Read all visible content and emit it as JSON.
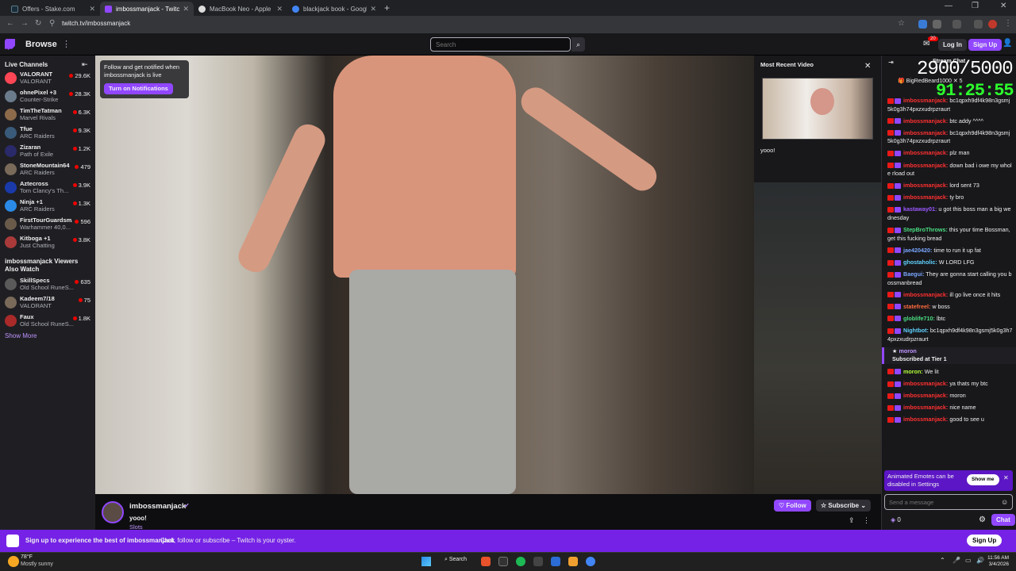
{
  "browser": {
    "tabs": [
      {
        "title": "Offers - Stake.com",
        "color": "#1a2c38"
      },
      {
        "title": "imbossmanjack - Twitch",
        "color": "#9147ff"
      },
      {
        "title": "MacBook Neo - Apple (UK)",
        "color": "#cccccc"
      },
      {
        "title": "blackjack book - Google Search",
        "color": "#4285f4"
      }
    ],
    "url": "twitch.tv/imbossmanjack"
  },
  "nav": {
    "browse": "Browse",
    "search_placeholder": "Search",
    "notif_count": "20",
    "login": "Log In",
    "signup": "Sign Up"
  },
  "sidebar": {
    "live_title": "Live Channels",
    "channels": [
      {
        "name": "VALORANT",
        "game": "VALORANT",
        "viewers": "29.6K",
        "color": "#ff4655"
      },
      {
        "name": "ohnePixel +3",
        "game": "Counter-Strike",
        "viewers": "28.3K",
        "color": "#6a7b8c"
      },
      {
        "name": "TimTheTatman",
        "game": "Marvel Rivals",
        "viewers": "6.3K",
        "color": "#8c6a4a"
      },
      {
        "name": "Tfue",
        "game": "ARC Raiders",
        "viewers": "9.3K",
        "color": "#3a5a7a"
      },
      {
        "name": "Zizaran",
        "game": "Path of Exile",
        "viewers": "1.2K",
        "color": "#2a2a6a"
      },
      {
        "name": "StoneMountain64",
        "game": "ARC Raiders",
        "viewers": "479",
        "color": "#7a6a5a"
      },
      {
        "name": "Aztecross",
        "game": "Tom Clancy's Th...",
        "viewers": "3.9K",
        "color": "#1a3aaa"
      },
      {
        "name": "Ninja +1",
        "game": "ARC Raiders",
        "viewers": "1.3K",
        "color": "#2a8ae6"
      },
      {
        "name": "FirstTourGuardsm...",
        "game": "Warhammer 40,0...",
        "viewers": "596",
        "color": "#6a5a4a"
      },
      {
        "name": "Kitboga +1",
        "game": "Just Chatting",
        "viewers": "3.8K",
        "color": "#aa3a3a"
      }
    ],
    "also_title": "imbossmanjack Viewers Also Watch",
    "also": [
      {
        "name": "SkillSpecs",
        "game": "Old School RuneS...",
        "viewers": "635",
        "color": "#5a5a5a"
      },
      {
        "name": "Kadeem7/18",
        "game": "VALORANT",
        "viewers": "75",
        "color": "#7a6a5a"
      },
      {
        "name": "Faux",
        "game": "Old School RuneS...",
        "viewers": "1.8K",
        "color": "#aa2a2a"
      }
    ],
    "show_more": "Show More"
  },
  "follow_popup": {
    "text": "Follow and get notified when imbossmanjack is live",
    "button": "Turn on Notifications"
  },
  "recent": {
    "title": "Most Recent Video",
    "caption": "yooo!"
  },
  "chat": {
    "title": "Stream Chat",
    "overlay_count": "2900/5000",
    "overlay_timer": "91:25:55",
    "pinned": "BigRedBeard1000 ✕ 5",
    "messages": [
      {
        "user": "imbossmanjack:",
        "text": " bc1qpxh9df4k98n3gsmj5k0g3h74pxzxudrpzraurt",
        "ucolor": "#ff3030"
      },
      {
        "user": "imbossmanjack:",
        "text": " btc addy ^^^^",
        "ucolor": "#ff3030"
      },
      {
        "user": "imbossmanjack:",
        "text": " bc1qpxh9df4k98n3gsmj5k0g3h74pxzxudrpzraurt",
        "ucolor": "#ff3030"
      },
      {
        "user": "imbossmanjack:",
        "text": " plz man",
        "ucolor": "#ff3030"
      },
      {
        "user": "imbossmanjack:",
        "text": " down bad i owe my whole rload out",
        "ucolor": "#ff3030"
      },
      {
        "user": "imbossmanjack:",
        "text": " lord sent 73",
        "ucolor": "#ff3030"
      },
      {
        "user": "imbossmanjack:",
        "text": " ty bro",
        "ucolor": "#ff3030"
      },
      {
        "user": "kastaway01:",
        "text": " u got this boss man a big wednesday",
        "ucolor": "#9b59ff"
      },
      {
        "user": "StepBroThrows:",
        "text": " this your time Bossman, get this fucking bread",
        "ucolor": "#4ade80"
      },
      {
        "user": "jae420420:",
        "text": " time to run it up fat",
        "ucolor": "#7aa7ff"
      },
      {
        "user": "ghostaholic:",
        "text": " W LORD LFG",
        "ucolor": "#5fd3ff"
      },
      {
        "user": "Baegui:",
        "text": " They are gonna start calling you bossmanbread",
        "ucolor": "#7aa7ff"
      },
      {
        "user": "imbossmanjack:",
        "text": " ill go live once it hits",
        "ucolor": "#ff3030"
      },
      {
        "user": "statefreel:",
        "text": " w boss",
        "ucolor": "#ff6a3d"
      },
      {
        "user": "globlife710:",
        "text": " lbtc",
        "ucolor": "#4ade80"
      },
      {
        "user": "Nightbot:",
        "text": " bc1qpxh9df4k98n3gsmj5k0g3h74pxzxudrpzraurt",
        "ucolor": "#5fd3ff"
      }
    ],
    "sub": {
      "user": "moron",
      "text": "Subscribed at Tier 1"
    },
    "messages2": [
      {
        "user": "moron:",
        "text": " We lit",
        "ucolor": "#b3ff3a"
      },
      {
        "user": "imbossmanjack:",
        "text": " ya thats my btc",
        "ucolor": "#ff3030"
      },
      {
        "user": "imbossmanjack:",
        "text": " moron",
        "ucolor": "#ff3030"
      },
      {
        "user": "imbossmanjack:",
        "text": " nice name",
        "ucolor": "#ff3030"
      },
      {
        "user": "imbossmanjack:",
        "text": " good to see u",
        "ucolor": "#ff3030"
      }
    ],
    "banner": "Animated Emotes can be disabled in Settings",
    "show_me": "Show me",
    "input_placeholder": "Send a message",
    "points": "0",
    "chat_button": "Chat"
  },
  "stream": {
    "channel": "imbossmanjack",
    "title": "yooo!",
    "category": "Slots",
    "follow": "Follow",
    "subscribe": "Subscribe"
  },
  "promo": {
    "bold": "Sign up to experience the best of imbossmanjack",
    "text": "Chat, follow or subscribe – Twitch is your oyster.",
    "button": "Sign Up"
  },
  "taskbar": {
    "temp": "78°F",
    "cond": "Mostly sunny",
    "search": "Search",
    "time": "11:56 AM",
    "date": "3/4/2026"
  }
}
